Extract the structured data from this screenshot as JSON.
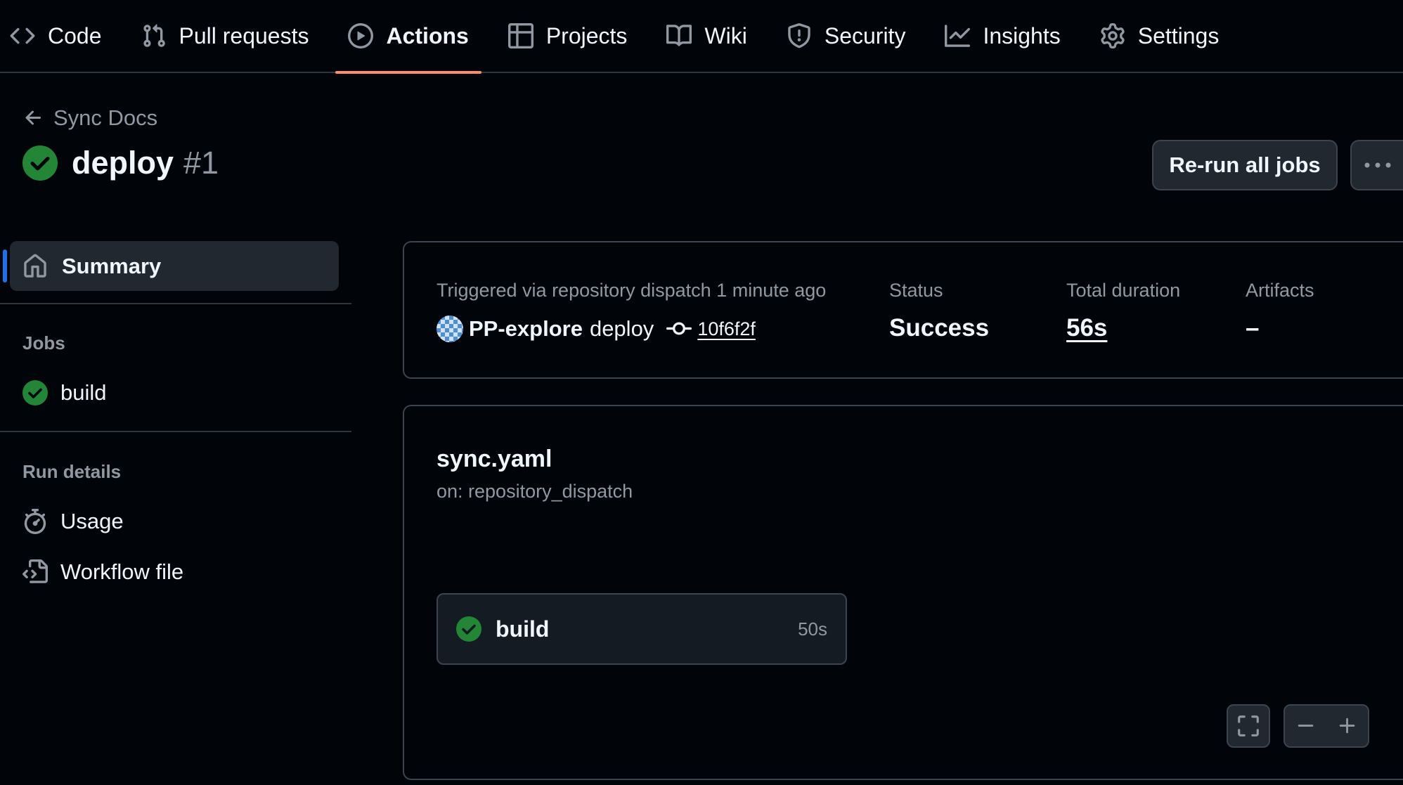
{
  "repo_nav": {
    "items": [
      {
        "label": "Code",
        "icon": "code-icon",
        "active": false
      },
      {
        "label": "Pull requests",
        "icon": "pull-request-icon",
        "active": false
      },
      {
        "label": "Actions",
        "icon": "play-circle-icon",
        "active": true
      },
      {
        "label": "Projects",
        "icon": "table-icon",
        "active": false
      },
      {
        "label": "Wiki",
        "icon": "book-icon",
        "active": false
      },
      {
        "label": "Security",
        "icon": "shield-icon",
        "active": false
      },
      {
        "label": "Insights",
        "icon": "graph-icon",
        "active": false
      },
      {
        "label": "Settings",
        "icon": "gear-icon",
        "active": false
      }
    ],
    "active_underline_color": "#fd8c73"
  },
  "header": {
    "back_label": "Sync Docs",
    "run_name": "deploy",
    "run_number": "#1",
    "rerun_label": "Re-run all jobs"
  },
  "sidebar": {
    "summary_label": "Summary",
    "jobs_heading": "Jobs",
    "jobs": [
      {
        "name": "build",
        "status": "success"
      }
    ],
    "run_details_heading": "Run details",
    "details": [
      {
        "label": "Usage",
        "icon": "stopwatch-icon"
      },
      {
        "label": "Workflow file",
        "icon": "file-code-icon"
      }
    ]
  },
  "summary": {
    "trigger_text": "Triggered via repository dispatch 1 minute ago",
    "actor": "PP-explore",
    "event": "deploy",
    "commit_sha": "10f6f2f",
    "status_label": "Status",
    "status_value": "Success",
    "duration_label": "Total duration",
    "duration_value": "56s",
    "artifacts_label": "Artifacts",
    "artifacts_value": "–"
  },
  "graph": {
    "workflow_file": "sync.yaml",
    "trigger": "on: repository_dispatch",
    "jobs": [
      {
        "name": "build",
        "duration": "50s",
        "status": "success"
      }
    ]
  },
  "colors": {
    "success": "#238636",
    "accent": "#1f6feb",
    "background": "#010409"
  }
}
